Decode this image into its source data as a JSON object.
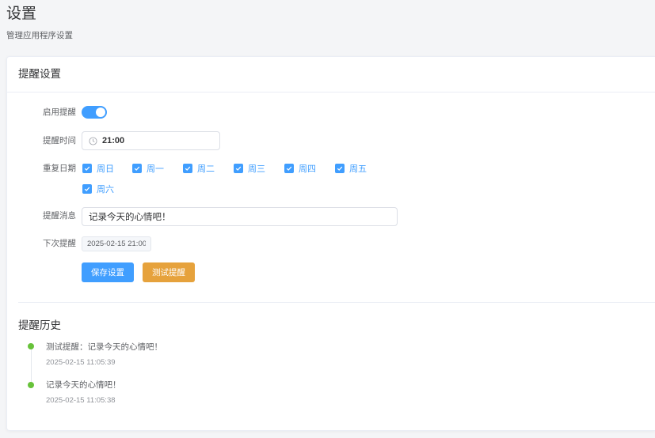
{
  "page": {
    "title": "设置",
    "subtitle": "管理应用程序设置"
  },
  "card": {
    "title": "提醒设置"
  },
  "form": {
    "enable_label": "启用提醒",
    "enabled": true,
    "time_label": "提醒时间",
    "time_value": "21:00",
    "repeat_label": "重复日期",
    "days": [
      {
        "label": "周日",
        "checked": true
      },
      {
        "label": "周一",
        "checked": true
      },
      {
        "label": "周二",
        "checked": true
      },
      {
        "label": "周三",
        "checked": true
      },
      {
        "label": "周四",
        "checked": true
      },
      {
        "label": "周五",
        "checked": true
      },
      {
        "label": "周六",
        "checked": true
      }
    ],
    "message_label": "提醒消息",
    "message_value": "记录今天的心情吧！",
    "next_label": "下次提醒",
    "next_value": "2025-02-15 21:00",
    "save_label": "保存设置",
    "test_label": "测试提醒"
  },
  "history": {
    "title": "提醒历史",
    "items": [
      {
        "text": "测试提醒：记录今天的心情吧！",
        "time": "2025-02-15 11:05:39"
      },
      {
        "text": "记录今天的心情吧！",
        "time": "2025-02-15 11:05:38"
      }
    ]
  },
  "icons": {
    "time": "clock-icon",
    "check": "check-icon",
    "timeline": "dot-icon"
  },
  "colors": {
    "primary": "#409eff",
    "warning": "#e6a23c",
    "success": "#67c23a"
  }
}
